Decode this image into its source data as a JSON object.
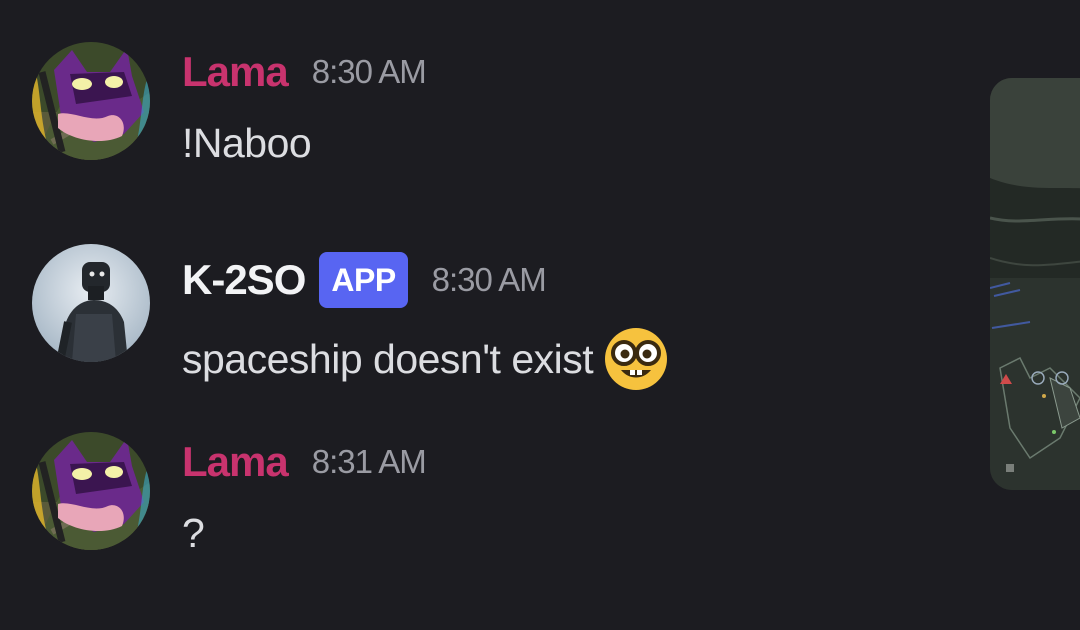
{
  "messages": [
    {
      "author": "Lama",
      "author_color": "#c8336e",
      "timestamp": "8:30 AM",
      "content": "!Naboo",
      "avatar": "masked-character-avatar"
    },
    {
      "author": "K-2SO",
      "author_color": "#f2f3f5",
      "badge": "APP",
      "badge_color": "#5865f2",
      "timestamp": "8:30 AM",
      "content": "spaceship doesn't exist",
      "emoji": "nerd-face-emoji",
      "avatar": "droid-avatar"
    },
    {
      "author": "Lama",
      "author_color": "#c8336e",
      "timestamp": "8:31 AM",
      "content": "?",
      "avatar": "masked-character-avatar"
    }
  ],
  "embed": {
    "icon": "map-screenshot-thumbnail"
  },
  "colors": {
    "background": "#1c1c21",
    "text": "#dcdde1",
    "timestamp": "#9a9ba3"
  }
}
